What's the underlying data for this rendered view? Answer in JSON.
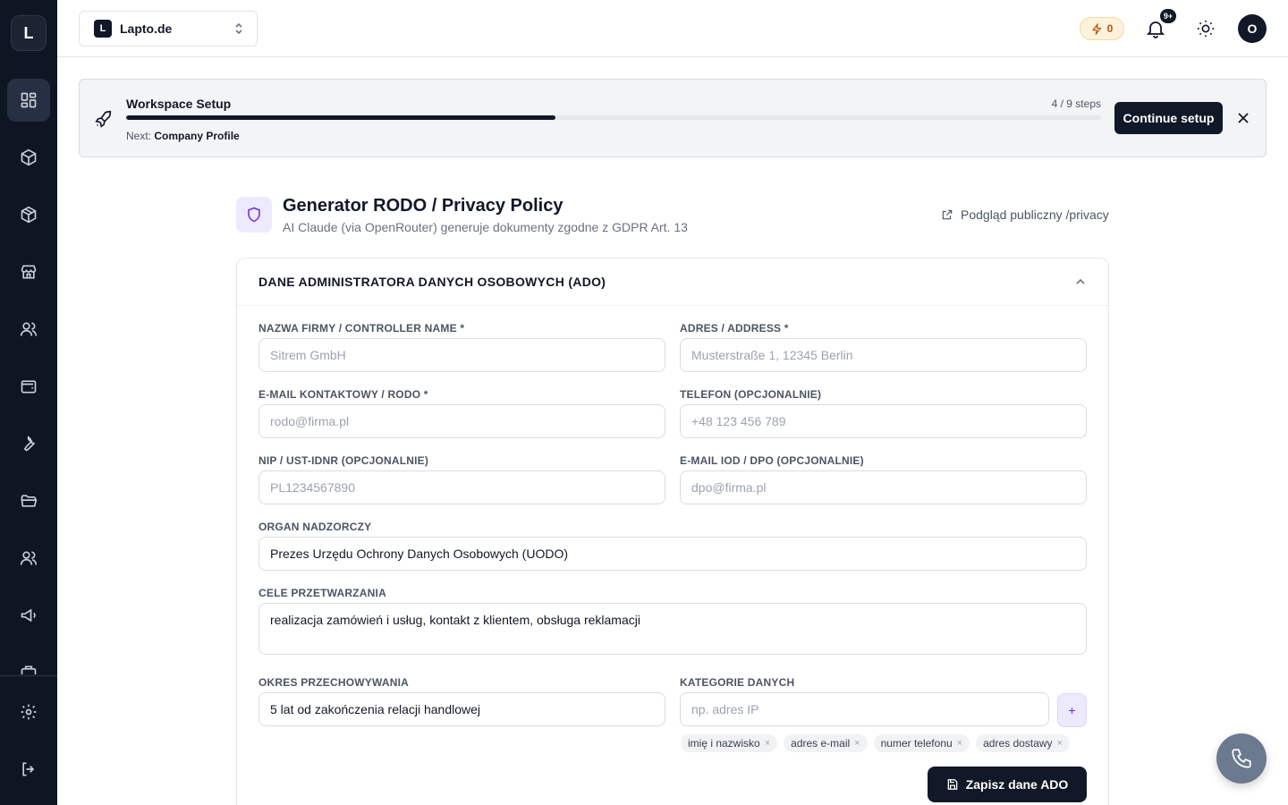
{
  "sidebar": {
    "logo": "L",
    "items": [
      {
        "name": "dashboard-icon"
      },
      {
        "name": "package-icon"
      },
      {
        "name": "box-icon"
      },
      {
        "name": "store-icon"
      },
      {
        "name": "users-icon"
      },
      {
        "name": "wallet-icon"
      },
      {
        "name": "wrench-icon"
      },
      {
        "name": "folder-icon"
      },
      {
        "name": "team-icon"
      },
      {
        "name": "megaphone-icon"
      }
    ],
    "bottom": [
      {
        "name": "gear-icon"
      },
      {
        "name": "logout-icon"
      }
    ]
  },
  "topbar": {
    "workspace_badge": "L",
    "workspace_name": "Lapto.de",
    "credits": "0",
    "notifications_badge": "9+",
    "avatar": "O"
  },
  "setup": {
    "title": "Workspace Setup",
    "steps": "4 / 9 steps",
    "progress": 0.44,
    "next_label": "Next:",
    "next_value": "Company Profile",
    "continue_label": "Continue setup"
  },
  "header": {
    "title": "Generator RODO / Privacy Policy",
    "subtitle": "AI Claude (via OpenRouter) generuje dokumenty zgodne z GDPR Art. 13",
    "preview_link": "Podgląd publiczny /privacy"
  },
  "card": {
    "title": "DANE ADMINISTRATORA DANYCH OSOBOWYCH (ADO)",
    "fields": {
      "controller_name": {
        "label": "NAZWA FIRMY / CONTROLLER NAME *",
        "placeholder": "Sitrem GmbH"
      },
      "address": {
        "label": "ADRES / ADDRESS *",
        "placeholder": "Musterstraße 1, 12345 Berlin"
      },
      "email": {
        "label": "E-MAIL KONTAKTOWY / RODO *",
        "placeholder": "rodo@firma.pl"
      },
      "phone": {
        "label": "TELEFON (OPCJONALNIE)",
        "placeholder": "+48 123 456 789"
      },
      "nip": {
        "label": "NIP / UST-IDNR (OPCJONALNIE)",
        "placeholder": "PL1234567890"
      },
      "dpo_email": {
        "label": "E-MAIL IOD / DPO (OPCJONALNIE)",
        "placeholder": "dpo@firma.pl"
      },
      "authority": {
        "label": "ORGAN NADZORCZY",
        "value": "Prezes Urzędu Ochrony Danych Osobowych (UODO)"
      },
      "purposes": {
        "label": "CELE PRZETWARZANIA",
        "value": "realizacja zamówień i usług, kontakt z klientem, obsługa reklamacji"
      },
      "retention": {
        "label": "OKRES PRZECHOWYWANIA",
        "value": "5 lat od zakończenia relacji handlowej"
      },
      "categories": {
        "label": "KATEGORIE DANYCH",
        "placeholder": "np. adres IP",
        "add": "+"
      }
    },
    "chips": [
      "imię i nazwisko",
      "adres e-mail",
      "numer telefonu",
      "adres dostawy"
    ],
    "chip_remove": "×",
    "save_label": "Zapisz dane ADO"
  }
}
